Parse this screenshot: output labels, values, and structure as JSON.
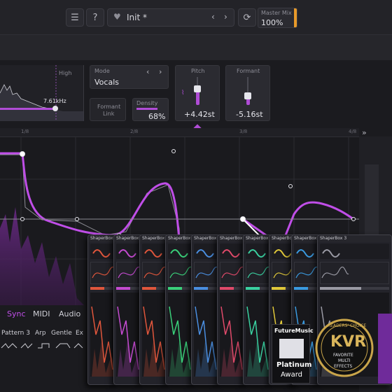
{
  "topbar": {
    "menu_icon": "hamburger-menu-icon",
    "help_icon": "help-question-icon",
    "preset_name": "Init *",
    "prev_arrow": "‹",
    "next_arrow": "›",
    "refresh_icon": "refresh-icon",
    "master_mix": {
      "label": "Master Mix",
      "value": "100%"
    }
  },
  "controls": {
    "spectrum": {
      "high_label": "High",
      "freq_value": "7.61kHz"
    },
    "mode": {
      "label": "Mode",
      "value": "Vocals",
      "prev": "‹",
      "next": "›"
    },
    "formant_link": {
      "label_line1": "Formant",
      "label_line2": "Link"
    },
    "density": {
      "label": "Density",
      "value": "68%"
    },
    "pitch": {
      "label": "Pitch",
      "value": "+4.42st"
    },
    "formant": {
      "label": "Formant",
      "value": "-5.16st"
    }
  },
  "ruler": {
    "marks": [
      "1/8",
      "2/8",
      "3/8",
      "4/8"
    ],
    "expand": "»"
  },
  "tabs": [
    {
      "label": "Sync",
      "active": true
    },
    {
      "label": "MIDI",
      "active": false
    },
    {
      "label": "Audio",
      "active": false
    }
  ],
  "shape_presets": [
    "Pattern 3",
    "Arp",
    "Gentle",
    "Ex"
  ],
  "product_boxes": [
    {
      "title": "ShaperBox",
      "accent": "#e0563c"
    },
    {
      "title": "ShaperBox",
      "accent": "#c44bd0"
    },
    {
      "title": "ShaperBox",
      "accent": "#e0563c"
    },
    {
      "title": "ShaperBox",
      "accent": "#3ad07a"
    },
    {
      "title": "ShaperBox",
      "accent": "#4a8ee0"
    },
    {
      "title": "ShaperBox",
      "accent": "#e04a6a"
    },
    {
      "title": "ShaperBox",
      "accent": "#3ad0a0"
    },
    {
      "title": "ShaperBox",
      "accent": "#e0c83a"
    },
    {
      "title": "ShaperBox",
      "accent": "#3a9ae0"
    },
    {
      "title": "ShaperBox 3",
      "accent": "#9a9aa4"
    }
  ],
  "awards": {
    "futuremusic": {
      "magazine": "FutureMusic",
      "line1": "Platinum",
      "line2": "Award"
    },
    "kvr": {
      "top": "READERS' CHOICE",
      "logo": "KVR",
      "line1": "FAVORITE",
      "line2": "MULTI",
      "line3": "EFFECTS"
    }
  },
  "colors": {
    "accent": "#b04cd6",
    "panel": "#2b2b31",
    "background": "#1b1b1f",
    "master_bar": "#e89a2a"
  }
}
